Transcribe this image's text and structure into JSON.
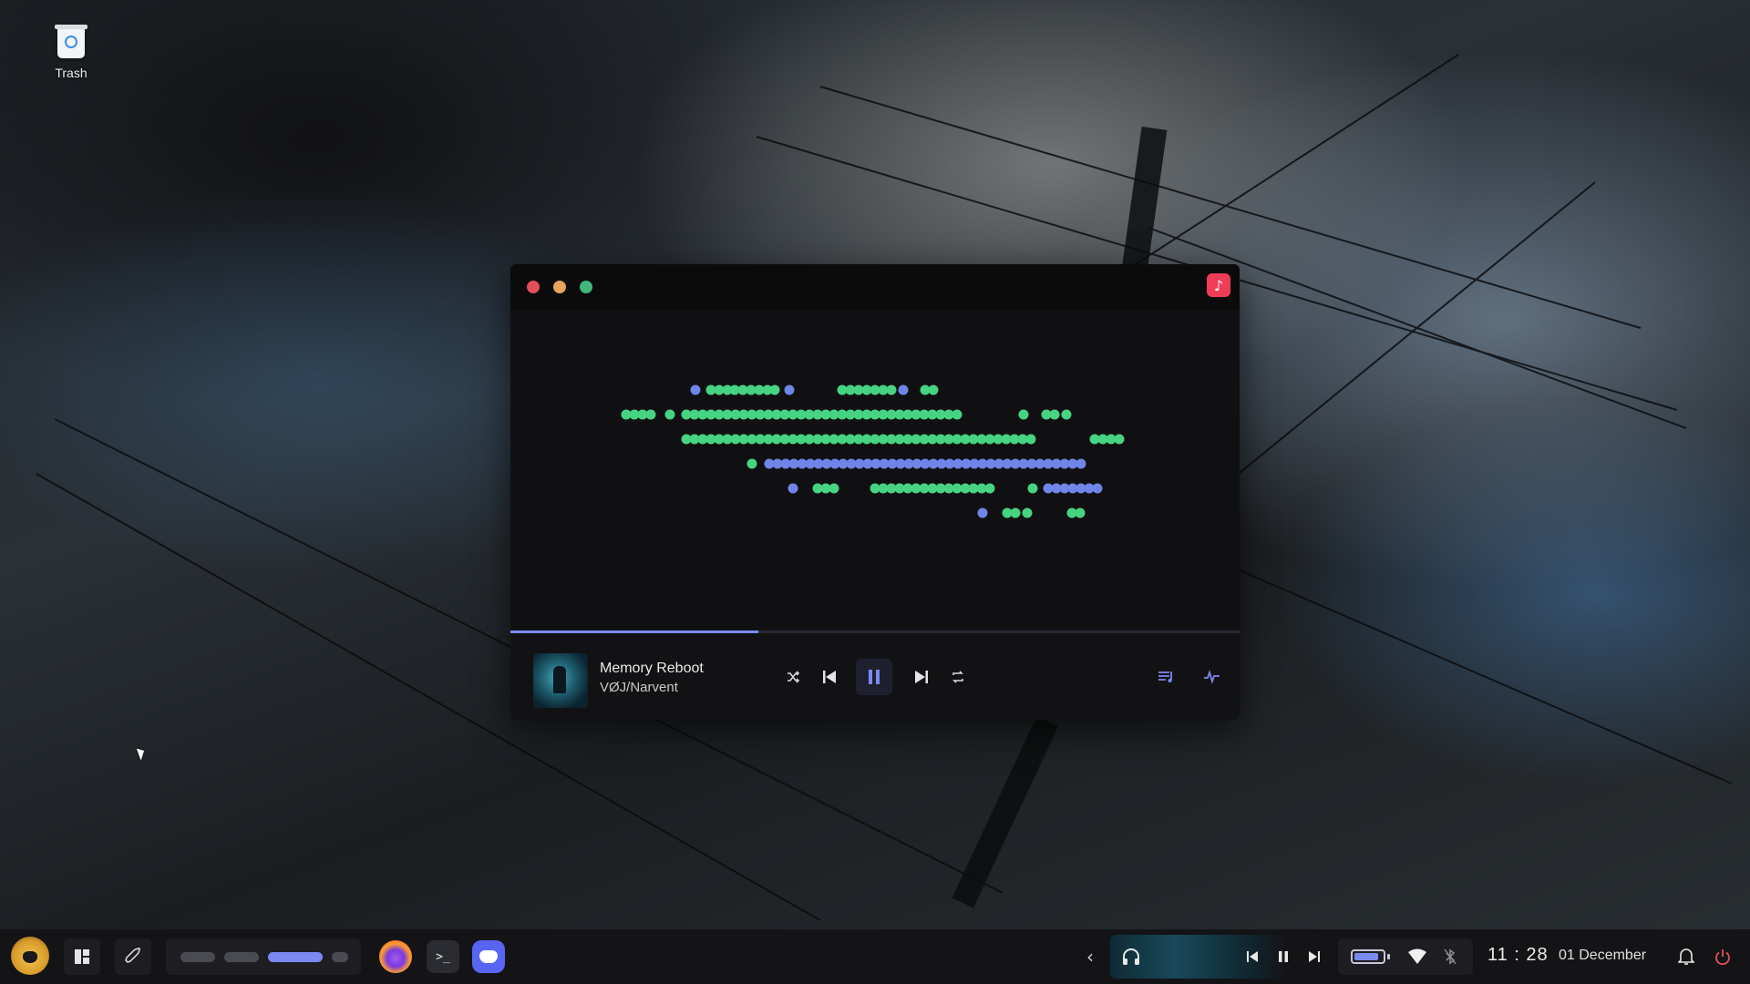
{
  "desktop": {
    "icons": [
      {
        "label": "Trash",
        "icon": "trash-icon"
      }
    ]
  },
  "player": {
    "window_controls": [
      "close",
      "minimize",
      "maximize"
    ],
    "app_icon": "music-note-icon",
    "accent": "#7b8af0",
    "visualizer_colors": {
      "green": "#46d483",
      "blue": "#6f86e8"
    },
    "track": {
      "title": "Memory Reboot",
      "artist": "VØJ/Narvent"
    },
    "progress": 0.34,
    "controls": [
      "shuffle-icon",
      "previous-icon",
      "pause-icon",
      "next-icon",
      "repeat-icon",
      "playlist-icon",
      "visualizer-icon"
    ]
  },
  "taskbar": {
    "workspaces": 4,
    "active_workspace": 3,
    "apps": [
      "firefox-icon",
      "terminal-icon",
      "discord-icon"
    ],
    "terminal_prompt": ">_",
    "media": [
      "headphones-icon",
      "previous-icon",
      "pause-icon",
      "next-icon"
    ],
    "battery_level": 0.85,
    "time": "11 : 28",
    "date": "01 December"
  }
}
